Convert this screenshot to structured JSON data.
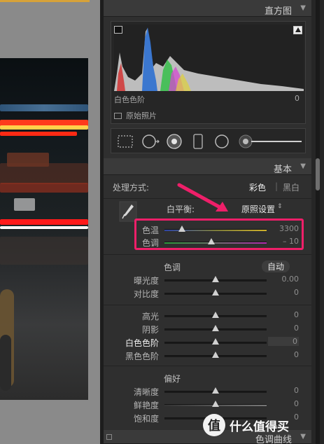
{
  "histogram": {
    "title": "直方图",
    "highlight_label": "白色色阶",
    "highlight_value": "0",
    "original_photo": "原始照片"
  },
  "basic": {
    "title": "基本",
    "treatment_label": "处理方式:",
    "treatment_color": "彩色",
    "treatment_bw": "黑白",
    "wb_label": "白平衡:",
    "wb_value": "原照设置",
    "temp": {
      "label": "色温",
      "value": "3300",
      "fraction": 0.17
    },
    "tint": {
      "label": "色调",
      "value": "– 10",
      "fraction": 0.46
    },
    "tone_label": "色调",
    "auto_label": "自动",
    "tone_sliders": [
      {
        "label": "曝光度",
        "value": "0.00",
        "fraction": 0.5
      },
      {
        "label": "对比度",
        "value": "0",
        "fraction": 0.5
      }
    ],
    "light_sliders": [
      {
        "label": "高光",
        "value": "0",
        "fraction": 0.5
      },
      {
        "label": "阴影",
        "value": "0",
        "fraction": 0.5
      },
      {
        "label": "白色色阶",
        "value": "0",
        "fraction": 0.5
      },
      {
        "label": "黑色色阶",
        "value": "0",
        "fraction": 0.5
      }
    ],
    "presence_label": "偏好",
    "presence_sliders": [
      {
        "label": "清晰度",
        "value": "0",
        "fraction": 0.5
      },
      {
        "label": "鲜艳度",
        "value": "0",
        "fraction": 0.5
      },
      {
        "label": "饱和度",
        "value": "0",
        "fraction": 0.5
      }
    ]
  },
  "tone_curve_title": "色调曲线",
  "watermark": {
    "logo": "值",
    "text": "什么值得买"
  },
  "colors": {
    "accent_pink": "#ee1f69",
    "panel": "#2f2f2f",
    "header": "#3a3a3a"
  }
}
